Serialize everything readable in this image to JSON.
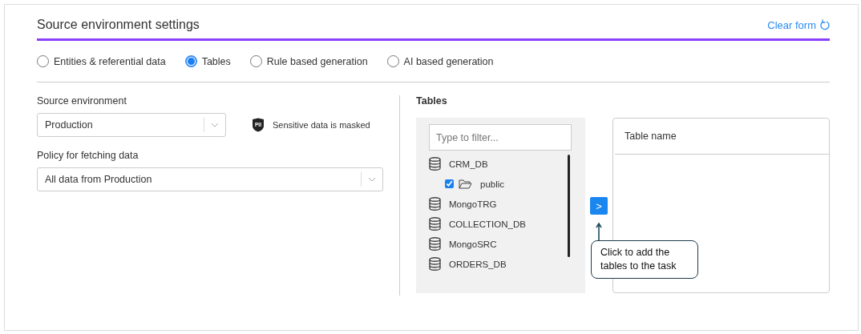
{
  "header": {
    "title": "Source environment settings",
    "clear_link": "Clear form"
  },
  "source_types": [
    {
      "label": "Entities & referential data",
      "selected": false
    },
    {
      "label": "Tables",
      "selected": true
    },
    {
      "label": "Rule based generation",
      "selected": false
    },
    {
      "label": "AI based generation",
      "selected": false
    }
  ],
  "source_environment": {
    "label": "Source environment",
    "value": "Production",
    "pii_badge": "PII",
    "pii_note": "Sensitive data is masked"
  },
  "fetch_policy": {
    "label": "Policy for fetching data",
    "value": "All data from Production"
  },
  "tables": {
    "label": "Tables",
    "filter": {
      "placeholder": "Type to filter..."
    },
    "tree": [
      {
        "name": "CRM_DB",
        "kind": "database",
        "children": [
          {
            "name": "public",
            "kind": "schema",
            "checked": true
          }
        ]
      },
      {
        "name": "MongoTRG",
        "kind": "database"
      },
      {
        "name": "COLLECTION_DB",
        "kind": "database"
      },
      {
        "name": "MongoSRC",
        "kind": "database"
      },
      {
        "name": "ORDERS_DB",
        "kind": "database"
      }
    ],
    "add_button": ">",
    "callout": "Click to add the tables to the task",
    "selected_column": "Table name"
  }
}
